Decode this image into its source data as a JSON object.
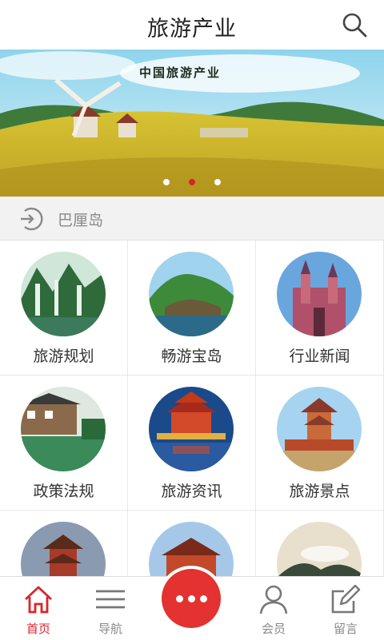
{
  "header": {
    "title": "旅游产业",
    "search_icon": "search-icon"
  },
  "banner": {
    "caption": "中国旅游产业",
    "active_slide": 2,
    "slide_count": 3
  },
  "location": {
    "icon": "location-switch-icon",
    "text": "巴厘岛"
  },
  "grid": {
    "items": [
      {
        "label": "旅游规划"
      },
      {
        "label": "畅游宝岛"
      },
      {
        "label": "行业新闻"
      },
      {
        "label": "政策法规"
      },
      {
        "label": "旅游资讯"
      },
      {
        "label": "旅游景点"
      },
      {
        "label": ""
      },
      {
        "label": ""
      },
      {
        "label": ""
      }
    ]
  },
  "bottom_nav": {
    "tabs": [
      {
        "label": "首页",
        "icon": "home-icon",
        "active": true
      },
      {
        "label": "导航",
        "icon": "menu-icon",
        "active": false
      },
      {
        "label": "会员",
        "icon": "user-icon",
        "active": false
      },
      {
        "label": "留言",
        "icon": "edit-icon",
        "active": false
      }
    ],
    "center_button_icon": "more-dots-icon"
  },
  "colors": {
    "accent": "#d8252c",
    "text_dark": "#222222",
    "text_muted": "#8a8a8a"
  }
}
